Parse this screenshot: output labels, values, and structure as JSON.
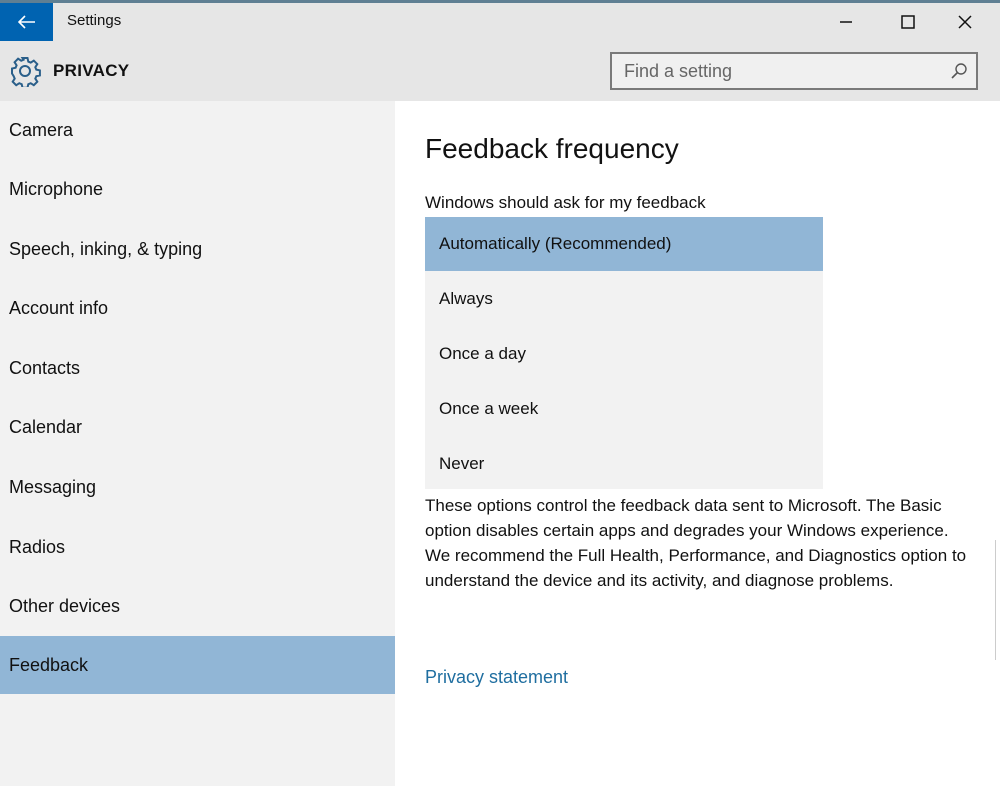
{
  "window": {
    "title": "Settings",
    "back_icon": "arrow-left-icon",
    "controls": {
      "minimize_icon": "minimize-icon",
      "maximize_icon": "maximize-icon",
      "close_icon": "close-icon"
    }
  },
  "header": {
    "icon": "gear-icon",
    "title": "PRIVACY",
    "search": {
      "placeholder": "Find a setting",
      "value": "",
      "icon": "search-icon"
    }
  },
  "sidebar": {
    "items": [
      {
        "label": "Camera",
        "selected": false
      },
      {
        "label": "Microphone",
        "selected": false
      },
      {
        "label": "Speech, inking, & typing",
        "selected": false
      },
      {
        "label": "Account info",
        "selected": false
      },
      {
        "label": "Contacts",
        "selected": false
      },
      {
        "label": "Calendar",
        "selected": false
      },
      {
        "label": "Messaging",
        "selected": false
      },
      {
        "label": "Radios",
        "selected": false
      },
      {
        "label": "Other devices",
        "selected": false
      },
      {
        "label": "Feedback",
        "selected": true
      }
    ]
  },
  "main": {
    "section_title": "Feedback frequency",
    "dropdown": {
      "label": "Windows should ask for my feedback",
      "selected": "Automatically (Recommended)",
      "options": [
        "Automatically (Recommended)",
        "Always",
        "Once a day",
        "Once a week",
        "Never"
      ]
    },
    "description": "These options control the feedback data sent to Microsoft. The Basic option disables certain apps and degrades your Windows experience. We recommend the Full Health, Performance, and Diagnostics option to understand the device and its activity, and diagnose problems.",
    "link": "Privacy statement"
  },
  "colors": {
    "accent": "#0063b1",
    "selection": "#91b6d6",
    "link": "#1f6ea0",
    "chrome": "#e6e6e6",
    "sidebar": "#f2f2f2"
  }
}
